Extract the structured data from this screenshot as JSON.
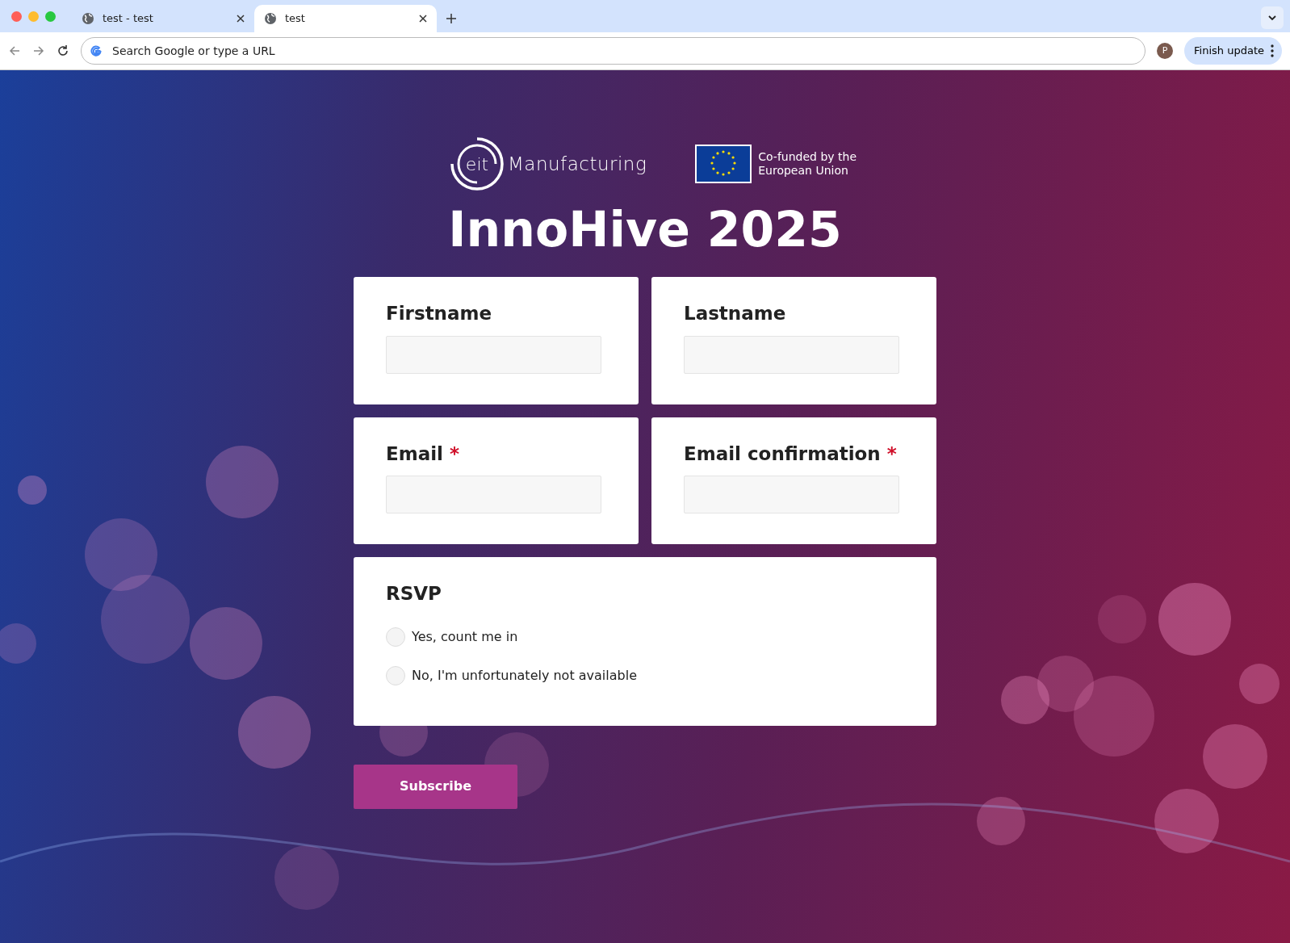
{
  "browser": {
    "tabs": [
      {
        "title": "test - test",
        "selected": false
      },
      {
        "title": "test",
        "selected": true
      }
    ],
    "address": {
      "placeholder": "Search Google or type a URL"
    },
    "profile_initial": "P",
    "update_button": "Finish update"
  },
  "logos": {
    "eit": {
      "mark": "eit",
      "name": "Manufacturing"
    },
    "eu": {
      "line_1": "Co-funded by the",
      "line_2": "European Union"
    }
  },
  "title": "InnoHive 2025",
  "fields": [
    {
      "label": "Firstname",
      "required": false
    },
    {
      "label": "Lastname",
      "required": false
    },
    {
      "label": "Email",
      "required": true
    },
    {
      "label": "Email confirmation",
      "required": true
    }
  ],
  "required_mark": "*",
  "rsvp": {
    "label": "RSVP",
    "options": [
      {
        "label": "Yes, count me in",
        "selected": false
      },
      {
        "label": "No, I'm unfortunately not available",
        "selected": false
      }
    ]
  },
  "submit": "Subscribe"
}
